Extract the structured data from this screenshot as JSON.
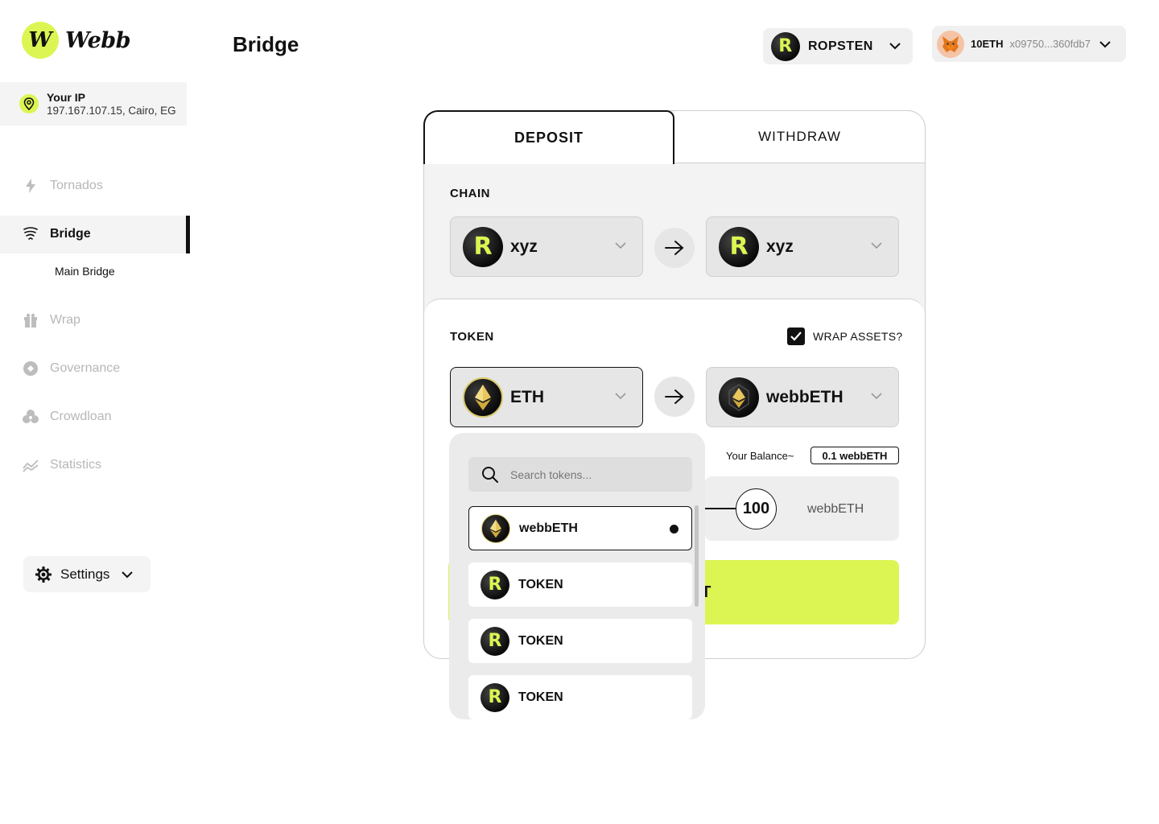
{
  "app": {
    "logo_text": "Webb",
    "logo_letter": "W"
  },
  "ip": {
    "title": "Your IP",
    "value": "197.167.107.15, Cairo, EG"
  },
  "sidebar": {
    "items": [
      {
        "label": "Tornados",
        "icon": "lightning-icon"
      },
      {
        "label": "Bridge",
        "icon": "tornado-icon",
        "active": true
      },
      {
        "label": "Wrap",
        "icon": "gift-icon"
      },
      {
        "label": "Governance",
        "icon": "governance-icon"
      },
      {
        "label": "Crowdloan",
        "icon": "crowdloan-icon"
      },
      {
        "label": "Statistics",
        "icon": "chart-line-icon"
      }
    ],
    "sub_item": "Main Bridge",
    "settings_label": "Settings"
  },
  "header": {
    "title": "Bridge",
    "network": "ROPSTEN",
    "wallet_balance": "10ETH",
    "wallet_address": "x09750...360fdb7"
  },
  "tabs": {
    "deposit": "DEPOSIT",
    "withdraw": "WITHDRAW"
  },
  "chain": {
    "label": "CHAIN",
    "from": "xyz",
    "to": "xyz"
  },
  "token": {
    "label": "TOKEN",
    "wrap_label": "WRAP ASSETS?",
    "wrap_checked": true,
    "from": "ETH",
    "to": "webbETH"
  },
  "balance": {
    "label": "Your Balance~",
    "value": "0.1 webbETH"
  },
  "amount": {
    "value": "100",
    "unit": "webbETH"
  },
  "submit_label": "DEPOSIT",
  "dropdown": {
    "search_placeholder": "Search tokens...",
    "items": [
      {
        "label": "webbETH",
        "icon": "eth-icon",
        "selected": true
      },
      {
        "label": "TOKEN",
        "icon": "r-token-icon"
      },
      {
        "label": "TOKEN",
        "icon": "r-token-icon"
      },
      {
        "label": "TOKEN",
        "icon": "r-token-icon"
      }
    ]
  },
  "colors": {
    "accent": "#dcf552",
    "dark": "#111111",
    "panel": "#f3f3f3"
  }
}
